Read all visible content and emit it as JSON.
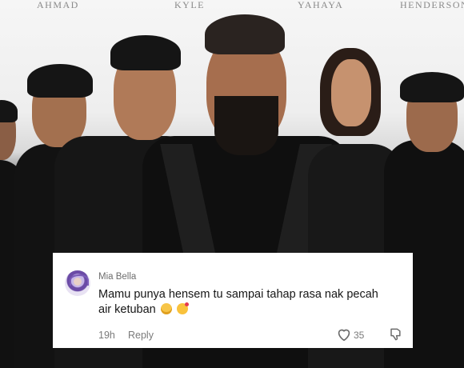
{
  "poster": {
    "names": [
      "AHMAD",
      "KYLE",
      "YAHAYA",
      "HENDERSON"
    ]
  },
  "comment": {
    "username": "Mia Bella",
    "text": "Mamu punya hensem tu sampai tahap rasa nak pecah air ketuban",
    "emojis": [
      "weary-face-emoji",
      "smiling-face-with-hearts-emoji"
    ],
    "time": "19h",
    "reply_label": "Reply",
    "like_count": "35",
    "icons": {
      "like": "heart-icon",
      "dislike": "thumbs-down-icon",
      "avatar": "avatar"
    }
  }
}
